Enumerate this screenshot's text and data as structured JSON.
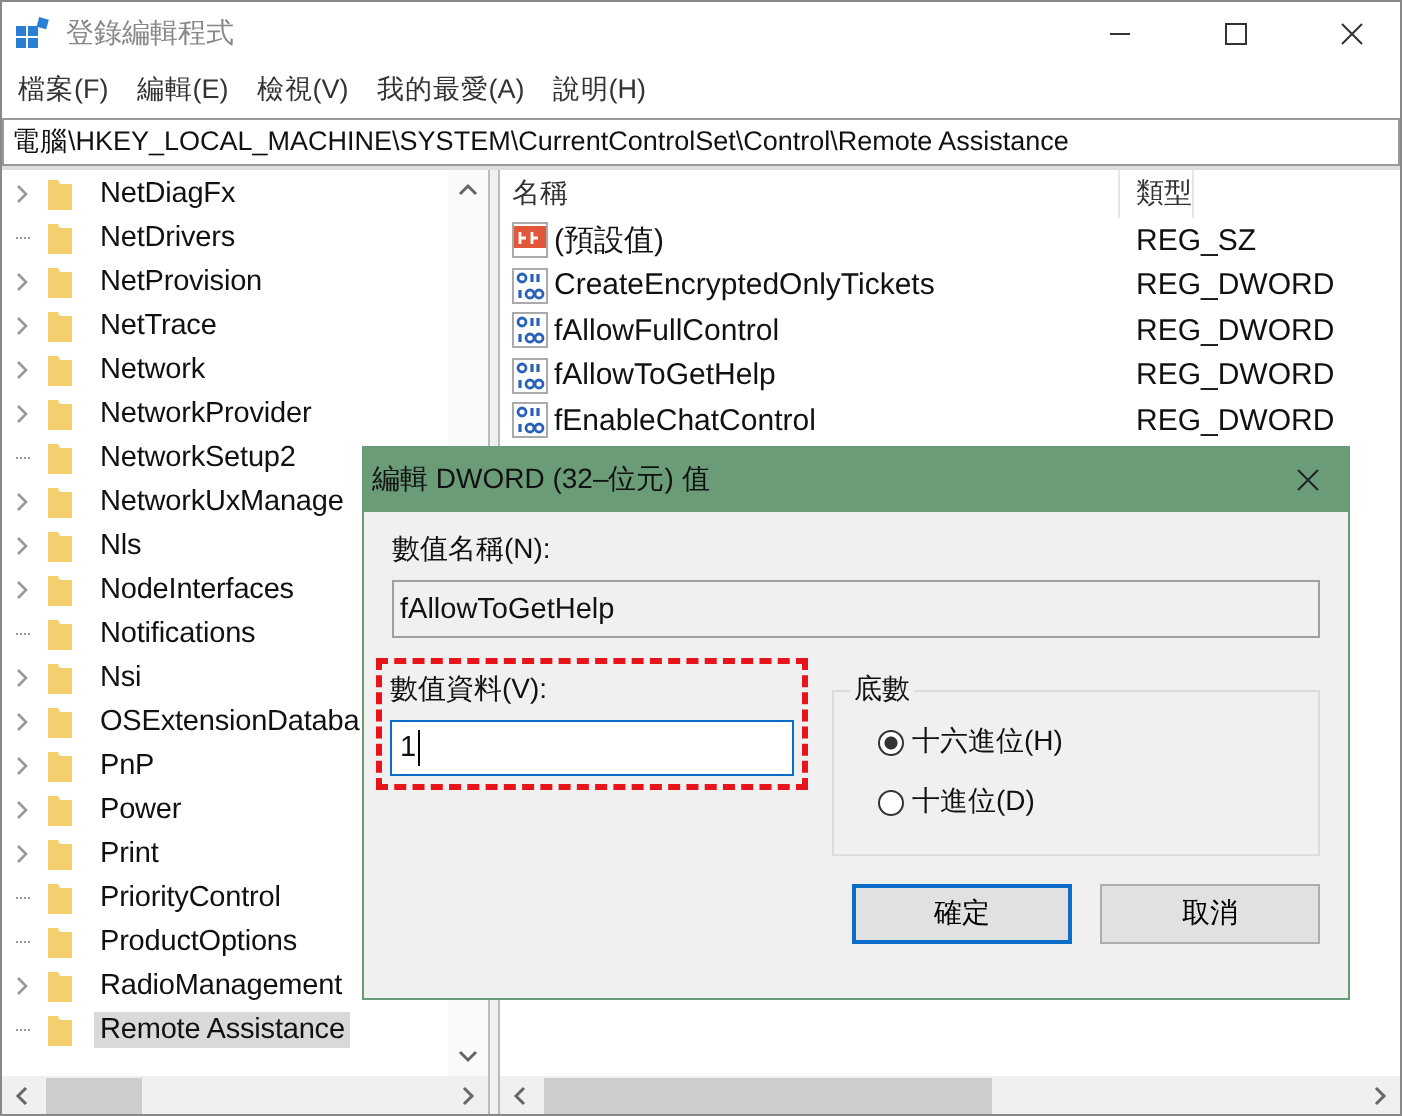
{
  "window": {
    "title": "登錄編輯程式"
  },
  "menu": [
    "檔案(F)",
    "編輯(E)",
    "檢視(V)",
    "我的最愛(A)",
    "說明(H)"
  ],
  "address": "電腦\\HKEY_LOCAL_MACHINE\\SYSTEM\\CurrentControlSet\\Control\\Remote Assistance",
  "tree": [
    {
      "label": "NetDiagFx",
      "expandable": true,
      "selected": false
    },
    {
      "label": "NetDrivers",
      "expandable": false,
      "selected": false
    },
    {
      "label": "NetProvision",
      "expandable": true,
      "selected": false
    },
    {
      "label": "NetTrace",
      "expandable": true,
      "selected": false
    },
    {
      "label": "Network",
      "expandable": true,
      "selected": false
    },
    {
      "label": "NetworkProvider",
      "expandable": true,
      "selected": false
    },
    {
      "label": "NetworkSetup2",
      "expandable": false,
      "selected": false
    },
    {
      "label": "NetworkUxManage",
      "expandable": true,
      "selected": false
    },
    {
      "label": "Nls",
      "expandable": true,
      "selected": false
    },
    {
      "label": "NodeInterfaces",
      "expandable": true,
      "selected": false
    },
    {
      "label": "Notifications",
      "expandable": false,
      "selected": false
    },
    {
      "label": "Nsi",
      "expandable": true,
      "selected": false
    },
    {
      "label": "OSExtensionDataba",
      "expandable": true,
      "selected": false
    },
    {
      "label": "PnP",
      "expandable": true,
      "selected": false
    },
    {
      "label": "Power",
      "expandable": true,
      "selected": false
    },
    {
      "label": "Print",
      "expandable": true,
      "selected": false
    },
    {
      "label": "PriorityControl",
      "expandable": false,
      "selected": false
    },
    {
      "label": "ProductOptions",
      "expandable": false,
      "selected": false
    },
    {
      "label": "RadioManagement",
      "expandable": true,
      "selected": false
    },
    {
      "label": "Remote Assistance",
      "expandable": false,
      "selected": true
    }
  ],
  "values": {
    "columns": [
      "名稱",
      "類型"
    ],
    "rows": [
      {
        "kind": "string",
        "name": "(預設值)",
        "type": "REG_SZ"
      },
      {
        "kind": "dword",
        "name": "CreateEncryptedOnlyTickets",
        "type": "REG_DWORD"
      },
      {
        "kind": "dword",
        "name": "fAllowFullControl",
        "type": "REG_DWORD"
      },
      {
        "kind": "dword",
        "name": "fAllowToGetHelp",
        "type": "REG_DWORD"
      },
      {
        "kind": "dword",
        "name": "fEnableChatControl",
        "type": "REG_DWORD"
      }
    ]
  },
  "dialog": {
    "title": "編輯 DWORD (32–位元) 值",
    "name_label": "數值名稱(N):",
    "name_value": "fAllowToGetHelp",
    "data_label": "數值資料(V):",
    "data_value": "1",
    "base_label": "底數",
    "base_options": [
      {
        "label": "十六進位(H)",
        "selected": true
      },
      {
        "label": "十進位(D)",
        "selected": false
      }
    ],
    "buttons": [
      "確定",
      "取消"
    ]
  }
}
